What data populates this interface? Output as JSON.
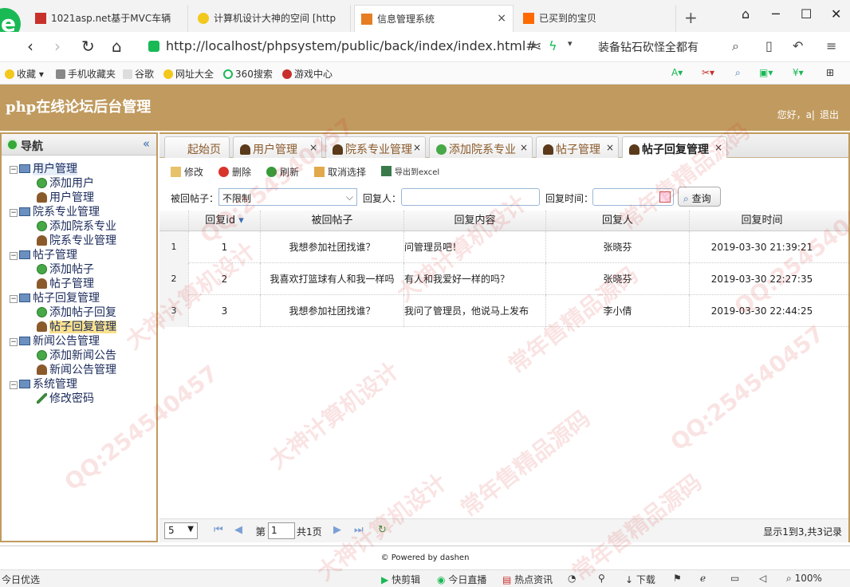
{
  "browser": {
    "tabs": [
      {
        "title": "1021asp.net基于MVC车辆",
        "active": false
      },
      {
        "title": "计算机设计大神的空间 [http",
        "active": false
      },
      {
        "title": "信息管理系统",
        "active": true
      },
      {
        "title": "已买到的宝贝",
        "active": false
      }
    ],
    "url": "http://localhost/phpsystem/public/back/index/index.html#",
    "search_hint": "装备钻石砍怪全都有",
    "bookmarks": [
      "收藏",
      "手机收藏夹",
      "谷歌",
      "网址大全",
      "360搜索",
      "游戏中心"
    ]
  },
  "app": {
    "title": "php在线论坛后台管理",
    "greeting": "您好，a|",
    "logout": "退出"
  },
  "nav": {
    "title": "导航",
    "groups": [
      {
        "label": "用户管理",
        "items": [
          "添加用户",
          "用户管理"
        ]
      },
      {
        "label": "院系专业管理",
        "items": [
          "添加院系专业",
          "院系专业管理"
        ]
      },
      {
        "label": "帖子管理",
        "items": [
          "添加帖子",
          "帖子管理"
        ]
      },
      {
        "label": "帖子回复管理",
        "items": [
          "添加帖子回复",
          "帖子回复管理"
        ]
      },
      {
        "label": "新闻公告管理",
        "items": [
          "添加新闻公告",
          "新闻公告管理"
        ]
      },
      {
        "label": "系统管理",
        "items": [
          "修改密码"
        ]
      }
    ],
    "selected_item": "帖子回复管理"
  },
  "tabs": [
    {
      "label": "起始页",
      "closable": false
    },
    {
      "label": "用户管理",
      "closable": true
    },
    {
      "label": "院系专业管理",
      "closable": true
    },
    {
      "label": "添加院系专业",
      "closable": true
    },
    {
      "label": "帖子管理",
      "closable": true
    },
    {
      "label": "帖子回复管理",
      "closable": true,
      "active": true
    }
  ],
  "toolbar": {
    "edit": "修改",
    "delete": "删除",
    "refresh": "刷新",
    "deselect": "取消选择",
    "export": "导出到excel"
  },
  "filters": {
    "post_label": "被回帖子：",
    "post_value": "不限制",
    "replier_label": "回复人：",
    "replier_value": "",
    "time_label": "回复时间：",
    "time_value": "",
    "query_button": "查询"
  },
  "grid": {
    "columns": [
      "回复id",
      "被回帖子",
      "回复内容",
      "回复人",
      "回复时间"
    ],
    "sort_column": "回复id",
    "rows": [
      {
        "num": "1",
        "id": "1",
        "post": "我想参加社团找谁？",
        "content": "问管理员吧！",
        "replier": "张晓芬",
        "time": "2019-03-30 21:39:21"
      },
      {
        "num": "2",
        "id": "2",
        "post": "我喜欢打篮球有人和我一样吗",
        "content": "有人和我爱好一样的吗？",
        "replier": "张晓芬",
        "time": "2019-03-30 22:27:35"
      },
      {
        "num": "3",
        "id": "3",
        "post": "我想参加社团找谁？",
        "content": "我问了管理员，他说马上发布",
        "replier": "李小倩",
        "time": "2019-03-30 22:44:25"
      }
    ]
  },
  "pager": {
    "page_size": "5",
    "page_prefix": "第",
    "page_value": "1",
    "page_suffix": "共1页",
    "summary": "显示1到3,共3记录"
  },
  "footer": "© Powered by dashen",
  "statusbar": {
    "left": "今日优选",
    "items": [
      "快剪辑",
      "今日直播",
      "热点资讯",
      "下载"
    ],
    "zoom": "100%"
  },
  "watermark": {
    "texts": [
      "QQ:254540457",
      "大神计算机设计",
      "常年售精品源码"
    ],
    "color": "#dc2828"
  },
  "colors": {
    "header_brown": "#c09a5e",
    "selected_bg": "#f9e08e"
  }
}
